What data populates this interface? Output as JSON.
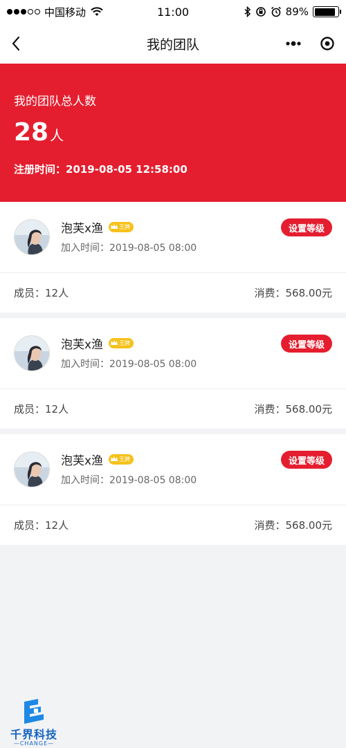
{
  "status_bar": {
    "carrier": "中国移动",
    "time": "11:00",
    "battery": "89%",
    "battery_level": 0.89,
    "signal_filled": 3,
    "signal_empty": 2
  },
  "nav": {
    "title": "我的团队",
    "back_icon": "chevron-left-icon",
    "more_icon": "more-dots-icon",
    "close_icon": "target-circle-icon"
  },
  "team": {
    "total_label": "我的团队总人数",
    "total_count": "28",
    "total_unit": "人",
    "register_time": "注册时间：2019-08-05  12:58:00"
  },
  "members": [
    {
      "name": "泡芙x渔",
      "badge": "王牌",
      "join_time": "加入时间：2019-08-05 08:00",
      "button": "设置等级",
      "members_label": "成员：12人",
      "consume_label": "消费：568.00元"
    },
    {
      "name": "泡芙x渔",
      "badge": "王牌",
      "join_time": "加入时间：2019-08-05 08:00",
      "button": "设置等级",
      "members_label": "成员：12人",
      "consume_label": "消费：568.00元"
    },
    {
      "name": "泡芙x渔",
      "badge": "王牌",
      "join_time": "加入时间：2019-08-05 08:00",
      "button": "设置等级",
      "members_label": "成员：12人",
      "consume_label": "消费：568.00元"
    }
  ],
  "watermark": {
    "text": "千界科技",
    "sub": "—CHANGE—"
  },
  "colors": {
    "accent": "#e41e2f",
    "badge": "#f6c11a",
    "background": "#f2f3f5"
  }
}
